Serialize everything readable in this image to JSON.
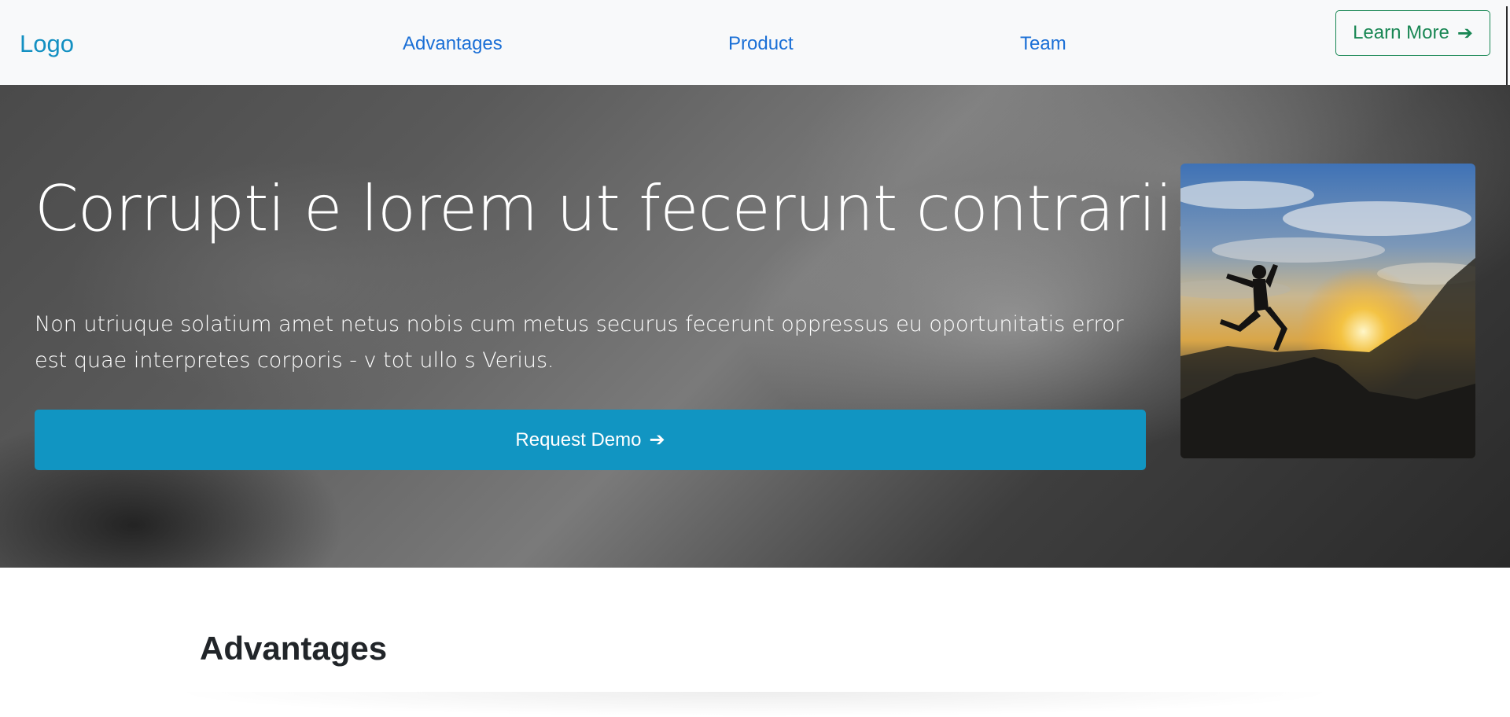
{
  "navbar": {
    "logo": "Logo",
    "links": [
      "Advantages",
      "Product",
      "Team"
    ],
    "cta_label": "Learn More",
    "cta_arrow": "➔"
  },
  "hero": {
    "title": "Corrupti e lorem ut fecerunt contrarii.",
    "description": "Non utriuque solatium amet netus nobis cum metus securus fecerunt oppressus eu oportunitatis error est quae interpretes corporis - v tot ullo s Verius.",
    "button_label": "Request Demo",
    "button_arrow": "➔",
    "image_icon": "jumping-silhouette-sunset-image"
  },
  "advantages": {
    "title": "Advantages"
  },
  "colors": {
    "brand": "#1390c2",
    "nav_link": "#1a6fd6",
    "success_outline": "#198754",
    "primary_button": "#1195c2",
    "navbar_bg": "#f8f9fa",
    "heading_text": "#212529"
  }
}
